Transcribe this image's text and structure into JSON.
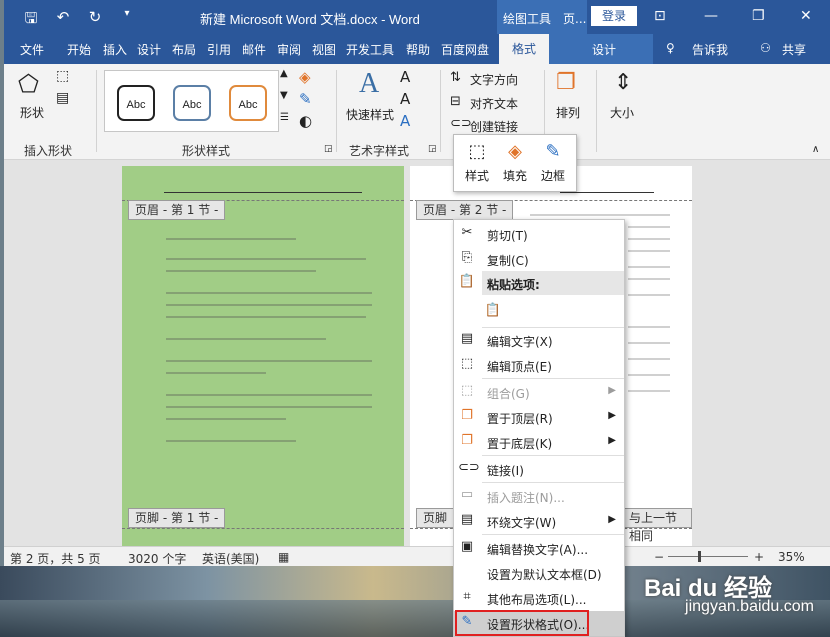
{
  "title_bar": {
    "doc_title": "新建 Microsoft Word 文档.docx  -  Word",
    "contextual_group_1": "绘图工具",
    "contextual_group_2": "页...",
    "login": "登录",
    "minimize": "—",
    "restore": "❐",
    "close": "✕"
  },
  "tabs": {
    "file": "文件",
    "home": "开始",
    "insert": "插入",
    "design": "设计",
    "layout": "布局",
    "references": "引用",
    "mailings": "邮件",
    "review": "审阅",
    "view": "视图",
    "developer": "开发工具",
    "help": "帮助",
    "baidu": "百度网盘",
    "format": "格式",
    "design2": "设计",
    "tell_me": "告诉我",
    "share": "共享"
  },
  "ribbon": {
    "shapes_label": "形状",
    "insert_shapes_group": "插入形状",
    "shape_styles_group": "形状样式",
    "abc": "Abc",
    "quick_styles": "快速样式",
    "wordart_group": "艺术字样式",
    "text_direction": "文字方向",
    "align_text": "对齐文本",
    "create_link": "创建链接",
    "arrange": "排列",
    "size": "大小"
  },
  "document": {
    "page1_header_tag": "页眉 - 第 1 节 -",
    "page2_header_tag": "页眉 - 第 2 节 -",
    "page1_footer_tag": "页脚 - 第 1 节 -",
    "page2_footer_tag": "页脚",
    "same_as_prev_tag": "与上一节相同"
  },
  "mini_toolbar": {
    "style": "样式",
    "fill": "填充",
    "border": "边框"
  },
  "context_menu": {
    "cut": "剪切(T)",
    "copy": "复制(C)",
    "paste_options": "粘贴选项:",
    "edit_text": "编辑文字(X)",
    "edit_points": "编辑顶点(E)",
    "group": "组合(G)",
    "bring_front": "置于顶层(R)",
    "send_back": "置于底层(K)",
    "link": "链接(I)",
    "insert_caption": "插入题注(N)...",
    "wrap_text": "环绕文字(W)",
    "edit_alt_text": "编辑替换文字(A)...",
    "set_default_textbox": "设置为默认文本框(D)",
    "more_layout": "其他布局选项(L)...",
    "format_shape": "设置形状格式(O)..."
  },
  "status_bar": {
    "page": "第 2 页，共 5 页",
    "words": "3020 个字",
    "language": "英语(美国)",
    "zoom": "35%"
  },
  "watermark": {
    "brand": "Bai du 经验",
    "url": "jingyan.baidu.com"
  },
  "colors": {
    "title_blue": "#2b579a",
    "contextual_blue": "#3b6fb5",
    "page_green": "#a1cd86",
    "highlight_red": "#e02020"
  }
}
